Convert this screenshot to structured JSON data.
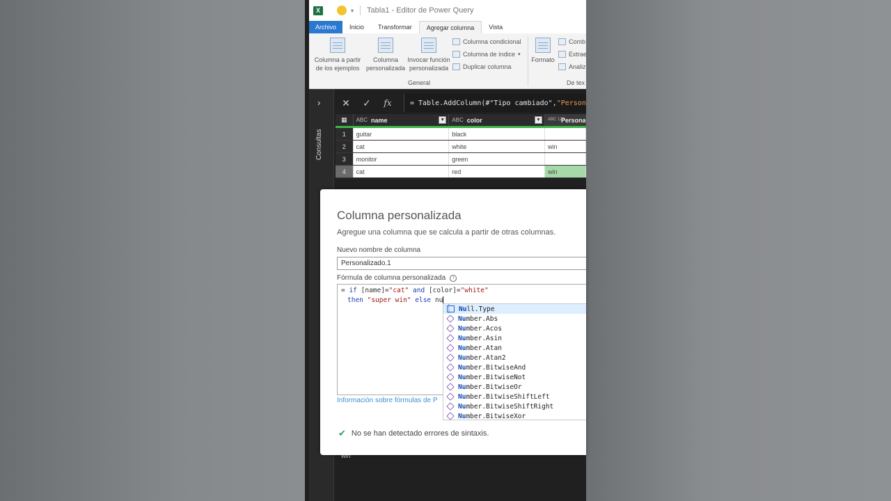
{
  "window": {
    "title": "Tabla1 - Editor de Power Query",
    "app_logo": "X"
  },
  "tabs": [
    {
      "label": "Archivo"
    },
    {
      "label": "Inicio"
    },
    {
      "label": "Transformar"
    },
    {
      "label": "Agregar columna"
    },
    {
      "label": "Vista"
    }
  ],
  "ribbon": {
    "col_examples": "Columna a partir de los ejemplos",
    "col_custom": "Columna personalizada",
    "invoke_fn": "Invocar función personalizada",
    "cond_col": "Columna condicional",
    "index_col": "Columna de índice",
    "dup_col": "Duplicar columna",
    "group_general": "General",
    "format": "Formato",
    "combine": "Comb",
    "extract": "Extrae",
    "analyze": "Analiz",
    "group_text": "De tex"
  },
  "queries_label": "Consultas",
  "formula_bar": {
    "prefix": "= Table.AddColumn(#\"Tipo cambiado\", ",
    "string_part": "\"Persona"
  },
  "grid": {
    "columns": [
      {
        "type": "ABC",
        "name": "name"
      },
      {
        "type": "ABC",
        "name": "color"
      },
      {
        "type": "ABC 123",
        "name": "Persona"
      }
    ],
    "rows": [
      {
        "n": "1",
        "name": "guitar",
        "color": "black",
        "custom": ""
      },
      {
        "n": "2",
        "name": "cat",
        "color": "white",
        "custom": "win"
      },
      {
        "n": "3",
        "name": "monitor",
        "color": "green",
        "custom": ""
      },
      {
        "n": "4",
        "name": "cat",
        "color": "red",
        "custom": "win"
      }
    ]
  },
  "dialog": {
    "title": "Columna personalizada",
    "subtitle": "Agregue una columna que se calcula a partir de otras columnas.",
    "name_label": "Nuevo nombre de columna",
    "name_value": "Personalizado.1",
    "formula_label": "Fórmula de columna personalizada",
    "formula_line1": {
      "eq": "= ",
      "if": "if",
      "a": " [name]=",
      "s1": "\"cat\"",
      "and": " and ",
      "b": "[color]=",
      "s2": "\"white\""
    },
    "formula_line2": {
      "then": "then",
      "s3": " \"super win\" ",
      "else": "else",
      "typed": " nu"
    },
    "help_link": "Información sobre fórmulas de P",
    "status": "No se han detectado errores de sintaxis."
  },
  "intellisense": [
    {
      "match": "Nu",
      "rest": "ll.Type",
      "kind": "enum"
    },
    {
      "match": "Nu",
      "rest": "mber.Abs",
      "kind": "fn"
    },
    {
      "match": "Nu",
      "rest": "mber.Acos",
      "kind": "fn"
    },
    {
      "match": "Nu",
      "rest": "mber.Asin",
      "kind": "fn"
    },
    {
      "match": "Nu",
      "rest": "mber.Atan",
      "kind": "fn"
    },
    {
      "match": "Nu",
      "rest": "mber.Atan2",
      "kind": "fn"
    },
    {
      "match": "Nu",
      "rest": "mber.BitwiseAnd",
      "kind": "fn"
    },
    {
      "match": "Nu",
      "rest": "mber.BitwiseNot",
      "kind": "fn"
    },
    {
      "match": "Nu",
      "rest": "mber.BitwiseOr",
      "kind": "fn"
    },
    {
      "match": "Nu",
      "rest": "mber.BitwiseShiftLeft",
      "kind": "fn"
    },
    {
      "match": "Nu",
      "rest": "mber.BitwiseShiftRight",
      "kind": "fn"
    },
    {
      "match": "Nu",
      "rest": "mber.BitwiseXor",
      "kind": "fn"
    }
  ],
  "below_text": "win"
}
